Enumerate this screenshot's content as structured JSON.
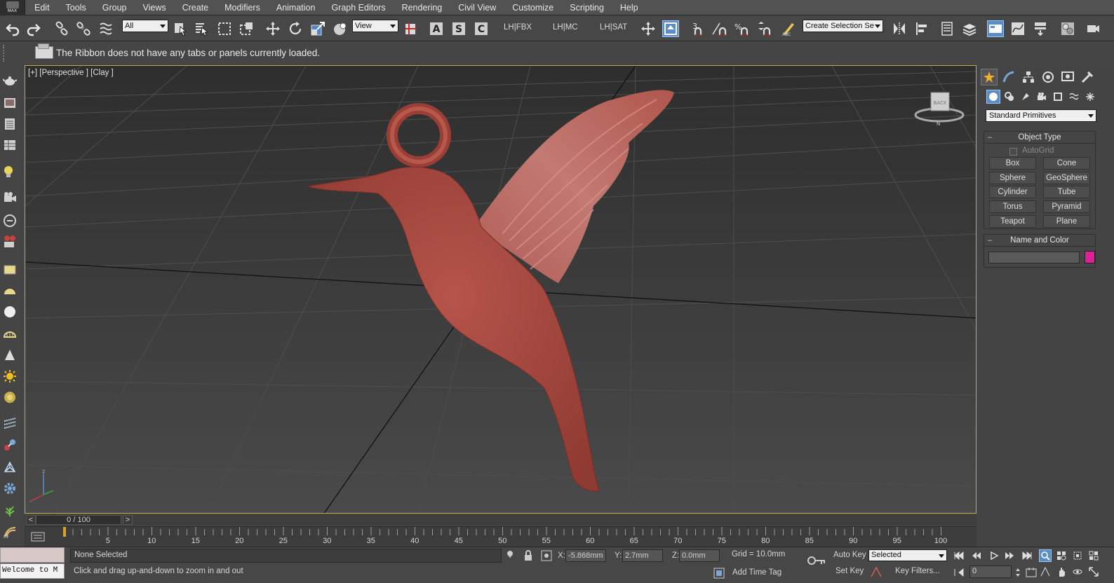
{
  "app": {
    "logo_text": "MAX"
  },
  "menu": [
    "Edit",
    "Tools",
    "Group",
    "Views",
    "Create",
    "Modifiers",
    "Animation",
    "Graph Editors",
    "Rendering",
    "Civil View",
    "Customize",
    "Scripting",
    "Help"
  ],
  "toolbar": {
    "selection_filter": "All",
    "ref_coord": "View",
    "lh_fbx": "LH|FBX",
    "lh_mc": "LH|MC",
    "lh_sat": "LH|SAT",
    "snap_number": "3",
    "named_selection": "Create Selection Se"
  },
  "ribbon": {
    "message": "The Ribbon does not have any tabs or panels currently loaded."
  },
  "viewport": {
    "label": "[+] [Perspective ] [Clay ]",
    "viewcube_face": "BACK",
    "model_color": "#a8473c",
    "border_color": "#c9a84a"
  },
  "command_panel": {
    "category": "Standard Primitives",
    "object_type": {
      "title": "Object Type",
      "autogrid": "AutoGrid",
      "buttons": [
        "Box",
        "Cone",
        "Sphere",
        "GeoSphere",
        "Cylinder",
        "Tube",
        "Torus",
        "Pyramid",
        "Teapot",
        "Plane"
      ]
    },
    "name_color": {
      "title": "Name and Color",
      "name_value": "",
      "color": "#e01f9a"
    }
  },
  "timeline": {
    "frame_display": "0 / 100",
    "ticks": [
      "5",
      "10",
      "15",
      "20",
      "25",
      "30",
      "35",
      "40",
      "45",
      "50",
      "55",
      "60",
      "65",
      "70",
      "75",
      "80",
      "85",
      "90",
      "95",
      "100"
    ]
  },
  "status": {
    "listener": "Welcome to M",
    "selection": "None Selected",
    "prompt": "Click and drag up-and-down to zoom in and out",
    "x_label": "X:",
    "x_value": "-5.868mm",
    "y_label": "Y:",
    "y_value": "2.7mm",
    "z_label": "Z:",
    "z_value": "0.0mm",
    "grid": "Grid = 10.0mm",
    "add_time_tag": "Add Time Tag",
    "auto_key": "Auto Key",
    "set_key": "Set Key",
    "key_mode": "Selected",
    "key_filters": "Key Filters...",
    "current_frame": "0"
  }
}
